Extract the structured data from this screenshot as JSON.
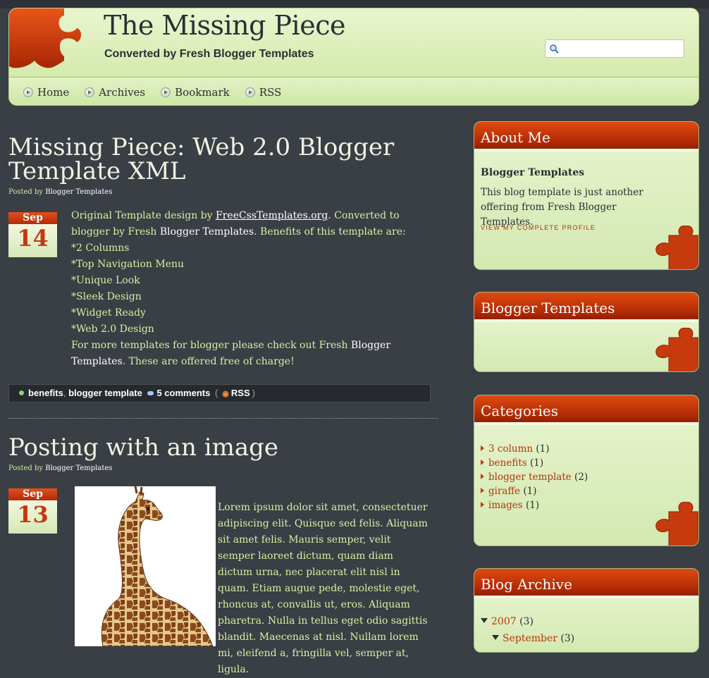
{
  "header": {
    "title": "The Missing Piece",
    "description": "Converted by Fresh Blogger Templates",
    "search_placeholder": ""
  },
  "nav": [
    {
      "label": "Home"
    },
    {
      "label": "Archives"
    },
    {
      "label": "Bookmark"
    },
    {
      "label": "RSS"
    }
  ],
  "post1": {
    "title": "Missing Piece: Web 2.0 Blogger Template XML",
    "posted_by": "Posted by",
    "author": "Blogger Templates",
    "month": "Sep",
    "day": "14",
    "intro_a": "Original Template design by ",
    "intro_link": "FreeCssTemplates.org",
    "intro_b": ". Converted to blogger by Fresh ",
    "intro_hl": "Blogger Templates",
    "intro_c": ". Benefits of this template are:",
    "features": [
      "*2 Columns",
      "*Top Navigation Menu",
      "*Unique Look",
      "*Sleek Design",
      "*Widget Ready",
      "*Web 2.0 Design"
    ],
    "outro_a": "For more templates for blogger please check out Fresh ",
    "outro_hl": "Blogger Templates",
    "outro_b": ". These are offered free of charge!",
    "labels": [
      "benefits",
      "blogger template"
    ],
    "comments": "5 comments",
    "rss": "RSS"
  },
  "post2": {
    "title": "Posting with an image",
    "posted_by": "Posted by",
    "author": "Blogger Templates",
    "month": "Sep",
    "day": "13",
    "body": "Lorem ipsum dolor sit amet, consectetuer adipiscing elit. Quisque sed felis. Aliquam sit amet felis. Mauris semper, velit semper laoreet dictum, quam diam dictum urna, nec placerat elit nisl in quam. Etiam augue pede, molestie eget, rhoncus at, convallis ut, eros. Aliquam pharetra. Nulla in tellus eget odio sagittis blandit. Maecenas at nisl. Nullam lorem mi, eleifend a, fringilla vel, semper at, ligula."
  },
  "sidebar": {
    "about": {
      "title": "About Me",
      "name": "Blogger Templates",
      "text": "This blog template is just another offering from Fresh Blogger Templates.",
      "profile_link": "VIEW MY COMPLETE PROFILE"
    },
    "blogger_templates": {
      "title": "Blogger Templates"
    },
    "categories": {
      "title": "Categories",
      "items": [
        {
          "label": "3 column",
          "count": "(1)"
        },
        {
          "label": "benefits",
          "count": "(1)"
        },
        {
          "label": "blogger template",
          "count": "(2)"
        },
        {
          "label": "giraffe",
          "count": "(1)"
        },
        {
          "label": "images",
          "count": "(1)"
        }
      ]
    },
    "archive": {
      "title": "Blog Archive",
      "year": "2007",
      "year_count": "(3)",
      "month": "September",
      "month_count": "(3)"
    }
  },
  "colors": {
    "background": "#3a3e45",
    "header_green": "#d6ebaf",
    "accent_orange": "#c13a10",
    "post_text": "#d9eea1"
  }
}
